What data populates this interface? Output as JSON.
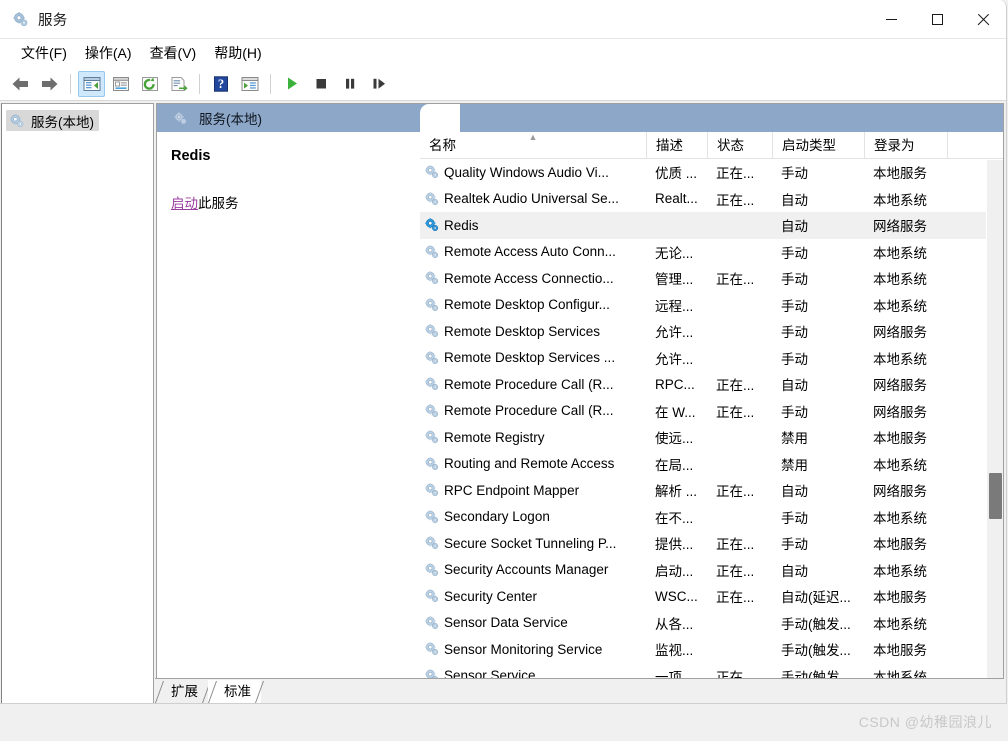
{
  "window": {
    "title": "服务",
    "icon": "services-gear-icon",
    "controls": {
      "minimize": "最小化",
      "maximize": "最大化",
      "close": "关闭"
    }
  },
  "menu": [
    {
      "label": "文件(F)",
      "name": "menu-file"
    },
    {
      "label": "操作(A)",
      "name": "menu-action"
    },
    {
      "label": "查看(V)",
      "name": "menu-view"
    },
    {
      "label": "帮助(H)",
      "name": "menu-help"
    }
  ],
  "toolbar": [
    {
      "name": "back-arrow-icon",
      "type": "back"
    },
    {
      "name": "forward-arrow-icon",
      "type": "forward"
    },
    {
      "name": "separator-1",
      "type": "sep"
    },
    {
      "name": "show-hide-console-tree-icon",
      "type": "tree",
      "active": true
    },
    {
      "name": "properties-icon",
      "type": "props"
    },
    {
      "name": "refresh-icon",
      "type": "refresh"
    },
    {
      "name": "export-list-icon",
      "type": "export"
    },
    {
      "name": "separator-2",
      "type": "sep"
    },
    {
      "name": "help-icon",
      "type": "help"
    },
    {
      "name": "show-action-pane-icon",
      "type": "actionpane"
    },
    {
      "name": "separator-3",
      "type": "sep"
    },
    {
      "name": "start-service-icon",
      "type": "play"
    },
    {
      "name": "stop-service-icon",
      "type": "stop"
    },
    {
      "name": "pause-service-icon",
      "type": "pause"
    },
    {
      "name": "restart-service-icon",
      "type": "restart"
    }
  ],
  "tree": {
    "nodes": [
      {
        "label": "服务(本地)",
        "selected": true,
        "icon": "services-gear-icon"
      }
    ]
  },
  "banner": {
    "title": "服务(本地)",
    "icon": "services-gear-icon"
  },
  "detail": {
    "service_name": "Redis",
    "action_link": "启动",
    "action_suffix": "此服务"
  },
  "columns": [
    {
      "key": "name",
      "label": "名称",
      "sorted": true
    },
    {
      "key": "desc",
      "label": "描述"
    },
    {
      "key": "status",
      "label": "状态"
    },
    {
      "key": "start",
      "label": "启动类型"
    },
    {
      "key": "logon",
      "label": "登录为"
    }
  ],
  "rows": [
    {
      "name": "Quality Windows Audio Vi...",
      "desc": "优质 ...",
      "status": "正在...",
      "start": "手动",
      "logon": "本地服务",
      "selected": false
    },
    {
      "name": "Realtek Audio Universal Se...",
      "desc": "Realt...",
      "status": "正在...",
      "start": "自动",
      "logon": "本地系统",
      "selected": false
    },
    {
      "name": "Redis",
      "desc": "",
      "status": "",
      "start": "自动",
      "logon": "网络服务",
      "selected": true
    },
    {
      "name": "Remote Access Auto Conn...",
      "desc": "无论...",
      "status": "",
      "start": "手动",
      "logon": "本地系统",
      "selected": false
    },
    {
      "name": "Remote Access Connectio...",
      "desc": "管理...",
      "status": "正在...",
      "start": "手动",
      "logon": "本地系统",
      "selected": false
    },
    {
      "name": "Remote Desktop Configur...",
      "desc": "远程...",
      "status": "",
      "start": "手动",
      "logon": "本地系统",
      "selected": false
    },
    {
      "name": "Remote Desktop Services",
      "desc": "允许...",
      "status": "",
      "start": "手动",
      "logon": "网络服务",
      "selected": false
    },
    {
      "name": "Remote Desktop Services ...",
      "desc": "允许...",
      "status": "",
      "start": "手动",
      "logon": "本地系统",
      "selected": false
    },
    {
      "name": "Remote Procedure Call (R...",
      "desc": "RPC...",
      "status": "正在...",
      "start": "自动",
      "logon": "网络服务",
      "selected": false
    },
    {
      "name": "Remote Procedure Call (R...",
      "desc": "在 W...",
      "status": "正在...",
      "start": "手动",
      "logon": "网络服务",
      "selected": false
    },
    {
      "name": "Remote Registry",
      "desc": "使远...",
      "status": "",
      "start": "禁用",
      "logon": "本地服务",
      "selected": false
    },
    {
      "name": "Routing and Remote Access",
      "desc": "在局...",
      "status": "",
      "start": "禁用",
      "logon": "本地系统",
      "selected": false
    },
    {
      "name": "RPC Endpoint Mapper",
      "desc": "解析 ...",
      "status": "正在...",
      "start": "自动",
      "logon": "网络服务",
      "selected": false
    },
    {
      "name": "Secondary Logon",
      "desc": "在不...",
      "status": "",
      "start": "手动",
      "logon": "本地系统",
      "selected": false
    },
    {
      "name": "Secure Socket Tunneling P...",
      "desc": "提供...",
      "status": "正在...",
      "start": "手动",
      "logon": "本地服务",
      "selected": false
    },
    {
      "name": "Security Accounts Manager",
      "desc": "启动...",
      "status": "正在...",
      "start": "自动",
      "logon": "本地系统",
      "selected": false
    },
    {
      "name": "Security Center",
      "desc": "WSC...",
      "status": "正在...",
      "start": "自动(延迟...",
      "logon": "本地服务",
      "selected": false
    },
    {
      "name": "Sensor Data Service",
      "desc": "从各...",
      "status": "",
      "start": "手动(触发...",
      "logon": "本地系统",
      "selected": false
    },
    {
      "name": "Sensor Monitoring Service",
      "desc": "监视...",
      "status": "",
      "start": "手动(触发...",
      "logon": "本地服务",
      "selected": false
    },
    {
      "name": "Sensor Service",
      "desc": "一项",
      "status": "正在",
      "start": "手动(触发",
      "logon": "本地系统",
      "selected": false
    }
  ],
  "tabs": [
    {
      "label": "扩展",
      "active": false
    },
    {
      "label": "标准",
      "active": true
    }
  ],
  "watermark": "CSDN @幼稚园浪儿",
  "colors": {
    "banner": "#8ca7c8",
    "selected_row": "#f0f0f0",
    "link": "#9a3fa0",
    "tree_selected": "#d8d8d8",
    "toolbar_active": "#cfe8fb"
  }
}
